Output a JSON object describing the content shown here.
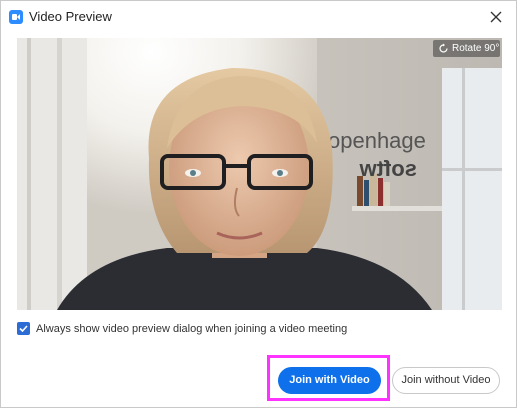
{
  "window": {
    "title": "Video Preview"
  },
  "video": {
    "rotate_label": "Rotate 90°",
    "wall_text_line1": "copenhage",
    "wall_text_line2": "softw"
  },
  "options": {
    "always_show_label": "Always show video preview dialog when joining a video meeting",
    "always_show_checked": true
  },
  "actions": {
    "join_with_video_label": "Join with Video",
    "join_without_video_label": "Join without Video"
  },
  "colors": {
    "accent": "#0e71eb",
    "highlight": "#ff33ff",
    "checkbox": "#2d6bd5"
  },
  "icons": {
    "app": "zoom-camera-icon",
    "close": "close-icon",
    "rotate": "rotate-icon",
    "check": "checkmark-icon"
  }
}
